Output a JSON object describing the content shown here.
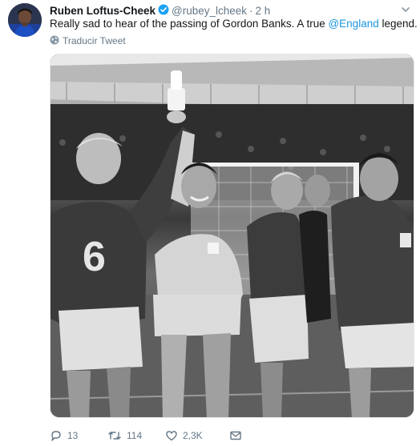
{
  "tweet": {
    "display_name": "Ruben Loftus-Cheek",
    "handle": "@rubey_lcheek",
    "separator": "·",
    "time": "2 h",
    "text_before": "Really sad to hear of the passing of Gordon Banks. A true ",
    "mention": "@England",
    "text_after": " legend.",
    "translate_label": "Traducir Tweet",
    "photo_jersey_number": "6"
  },
  "actions": {
    "replies": "13",
    "retweets": "114",
    "likes": "2,3K"
  },
  "colors": {
    "link": "#1b95e0",
    "muted": "#657786",
    "verified": "#1da1f2"
  }
}
